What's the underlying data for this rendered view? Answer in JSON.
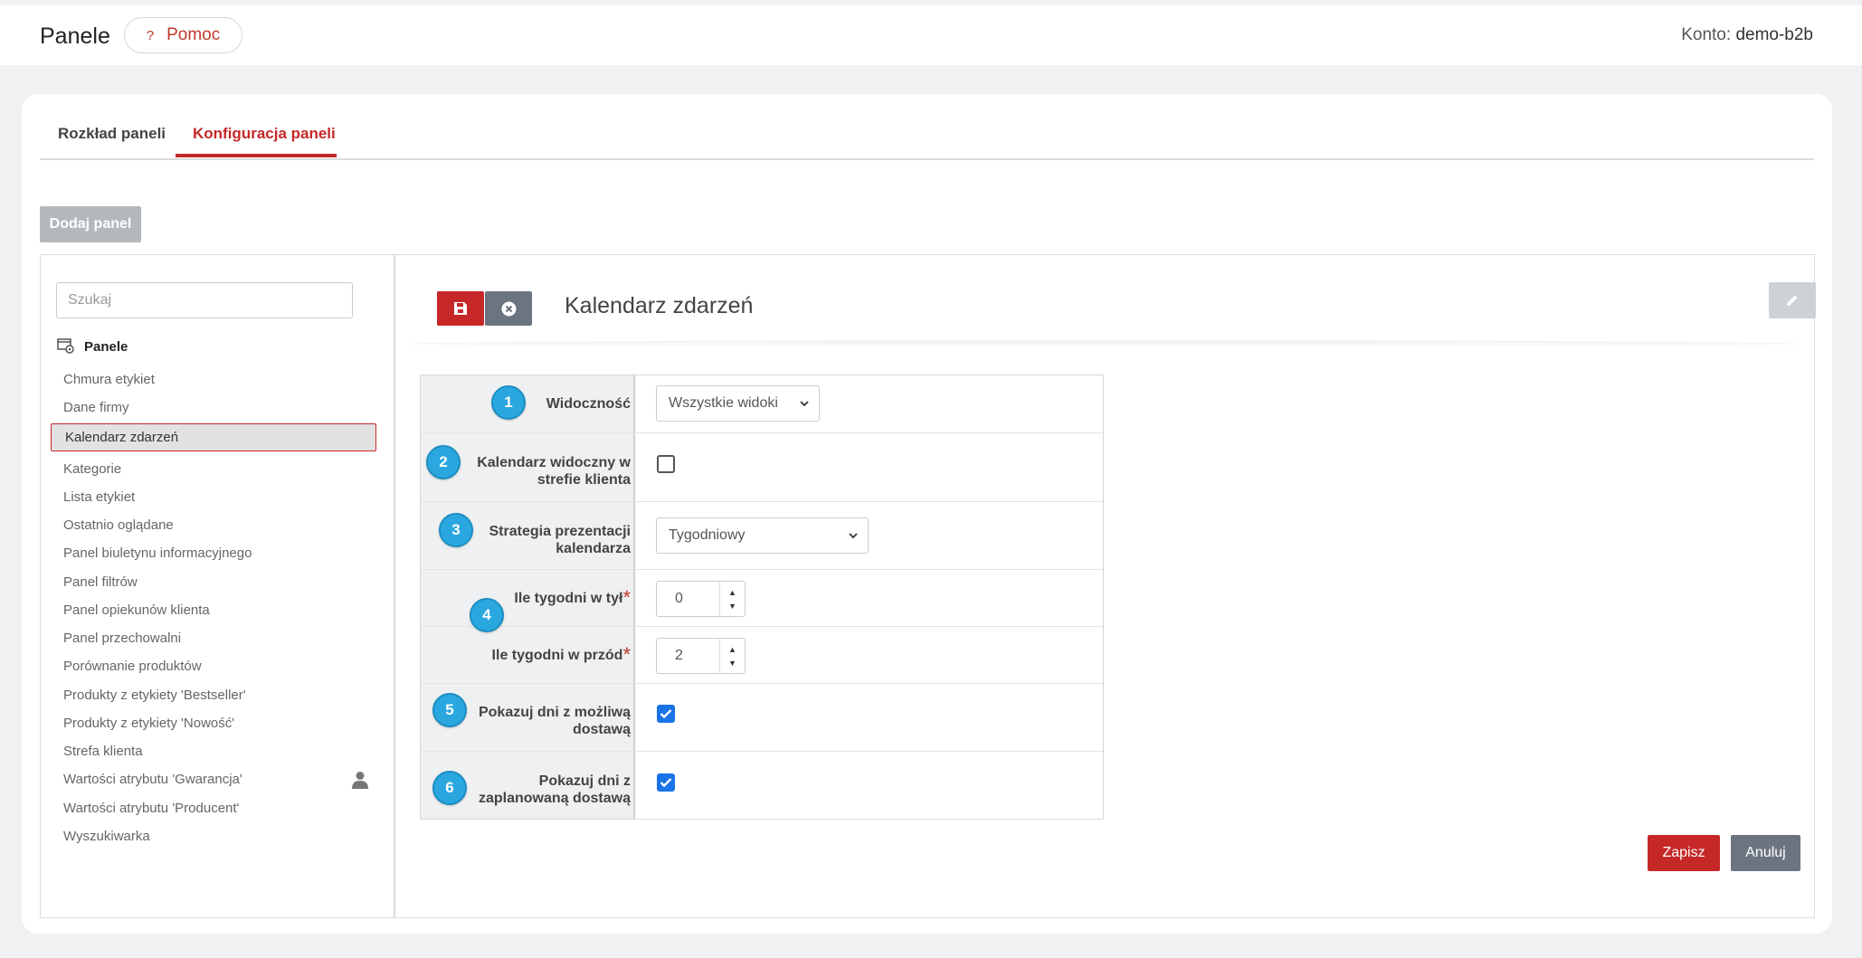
{
  "header": {
    "title": "Panele",
    "help_label": "Pomoc",
    "help_icon": "?",
    "account_label": "Konto:",
    "account_name": "demo-b2b"
  },
  "tabs": [
    {
      "label": "Rozkład paneli",
      "active": false
    },
    {
      "label": "Konfiguracja paneli",
      "active": true
    }
  ],
  "toolbar": {
    "add_panel_label": "Dodaj panel"
  },
  "sidebar": {
    "search_placeholder": "Szukaj",
    "root_label": "Panele",
    "items": [
      "Chmura etykiet",
      "Dane firmy",
      "Kalendarz zdarzeń",
      "Kategorie",
      "Lista etykiet",
      "Ostatnio oglądane",
      "Panel biuletynu informacyjnego",
      "Panel filtrów",
      "Panel opiekunów klienta",
      "Panel przechowalni",
      "Porównanie produktów",
      "Produkty z etykiety 'Bestseller'",
      "Produkty z etykiety 'Nowość'",
      "Strefa klienta",
      "Wartości atrybutu 'Gwarancja'",
      "Wartości atrybutu 'Producent'",
      "Wyszukiwarka"
    ],
    "selected_item": "Kalendarz zdarzeń"
  },
  "panel": {
    "title": "Kalendarz zdarzeń"
  },
  "form": {
    "visibility": {
      "badge": "1",
      "label": "Widoczność",
      "value": "Wszystkie widoki"
    },
    "calendar_visible": {
      "badge": "2",
      "label_line1": "Kalendarz widoczny w",
      "label_line2": "strefie klienta",
      "checked": false
    },
    "strategy": {
      "badge": "3",
      "label_line1": "Strategia prezentacji",
      "label_line2": "kalendarza",
      "value": "Tygodniowy"
    },
    "weeks_back": {
      "badge": "4",
      "label": "Ile tygodni w tył",
      "value": "0",
      "required": "*"
    },
    "weeks_forward": {
      "label": "Ile tygodni w przód",
      "value": "2",
      "required": "*"
    },
    "show_possible_delivery": {
      "badge": "5",
      "label_line1": "Pokazuj dni z możliwą",
      "label_line2": "dostawą",
      "checked": true
    },
    "show_planned_delivery": {
      "badge": "6",
      "label_line1": "Pokazuj dni z",
      "label_line2": "zaplanowaną dostawą",
      "checked": true
    }
  },
  "actions": {
    "save_label": "Zapisz",
    "cancel_label": "Anuluj"
  },
  "colors": {
    "accent": "#c62828",
    "badge": "#2aa7df",
    "secondary": "#6b7480"
  }
}
